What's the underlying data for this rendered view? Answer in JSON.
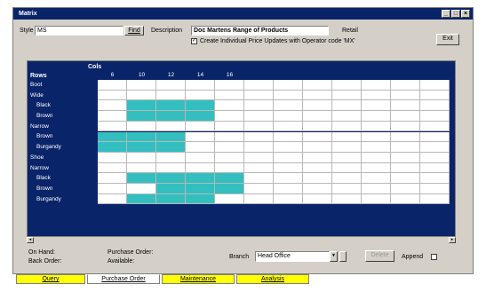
{
  "window": {
    "title": "Matrix"
  },
  "titlebar_buttons": [
    "_",
    "□",
    "×"
  ],
  "form": {
    "style_label": "Style",
    "style_value": "MS",
    "find_label": "Find",
    "description_label": "Description",
    "description_value": "Doc Martens Range of Products",
    "retail_label": "Retail",
    "create_updates_label": "Create Individual Price Updates with Operator code 'MX'",
    "create_updates_checked": true,
    "exit_label": "Exit"
  },
  "matrix": {
    "cols_header": "Cols",
    "rows_header": "Rows",
    "columns": [
      "6",
      "10",
      "12",
      "14",
      "16",
      "",
      "",
      "",
      "",
      "",
      "",
      ""
    ],
    "rows": [
      {
        "label": "Boot",
        "bold": false
      },
      {
        "label": "Wide",
        "bold": false
      },
      {
        "label": "Black",
        "bold": false,
        "indent": true
      },
      {
        "label": "Brown",
        "bold": false,
        "indent": true
      },
      {
        "label": "Narrow",
        "bold": false
      },
      {
        "label": "Brown",
        "bold": false,
        "indent": true
      },
      {
        "label": "Burgandy",
        "bold": false,
        "indent": true
      },
      {
        "label": "Shoe",
        "bold": false
      },
      {
        "label": "Narrow",
        "bold": false
      },
      {
        "label": "Black",
        "bold": false,
        "indent": true
      },
      {
        "label": "Brown",
        "bold": false,
        "indent": true
      },
      {
        "label": "Burgandy",
        "bold": false,
        "indent": true
      }
    ],
    "filled": [
      [
        0,
        0,
        0,
        0,
        0,
        0,
        0,
        0,
        0,
        0,
        0,
        0
      ],
      [
        0,
        0,
        0,
        0,
        0,
        0,
        0,
        0,
        0,
        0,
        0,
        0
      ],
      [
        0,
        1,
        1,
        1,
        0,
        0,
        0,
        0,
        0,
        0,
        0,
        0
      ],
      [
        0,
        1,
        1,
        1,
        0,
        0,
        0,
        0,
        0,
        0,
        0,
        0
      ],
      [
        0,
        0,
        0,
        0,
        0,
        0,
        0,
        0,
        0,
        0,
        0,
        0
      ],
      [
        1,
        1,
        1,
        0,
        0,
        0,
        0,
        0,
        0,
        0,
        0,
        0
      ],
      [
        1,
        1,
        1,
        0,
        0,
        0,
        0,
        0,
        0,
        0,
        0,
        0
      ],
      [
        0,
        0,
        0,
        0,
        0,
        0,
        0,
        0,
        0,
        0,
        0,
        0
      ],
      [
        0,
        0,
        0,
        0,
        0,
        0,
        0,
        0,
        0,
        0,
        0,
        0
      ],
      [
        0,
        1,
        1,
        1,
        1,
        0,
        0,
        0,
        0,
        0,
        0,
        0
      ],
      [
        0,
        0,
        1,
        1,
        1,
        0,
        0,
        0,
        0,
        0,
        0,
        0
      ],
      [
        0,
        1,
        1,
        1,
        0,
        0,
        0,
        0,
        0,
        0,
        0,
        0
      ]
    ]
  },
  "bottom": {
    "on_hand": "On Hand:",
    "back_order": "Back Order:",
    "purchase_order": "Purchase Order:",
    "available": "Available:",
    "branch_label": "Branch",
    "branch_value": "Head Office",
    "delete_label": "Delete",
    "append_label": "Append",
    "append_checked": false
  },
  "tabs": [
    "Query",
    "Purchase Order",
    "Maintenance",
    "Analysis"
  ],
  "active_tab": 1
}
